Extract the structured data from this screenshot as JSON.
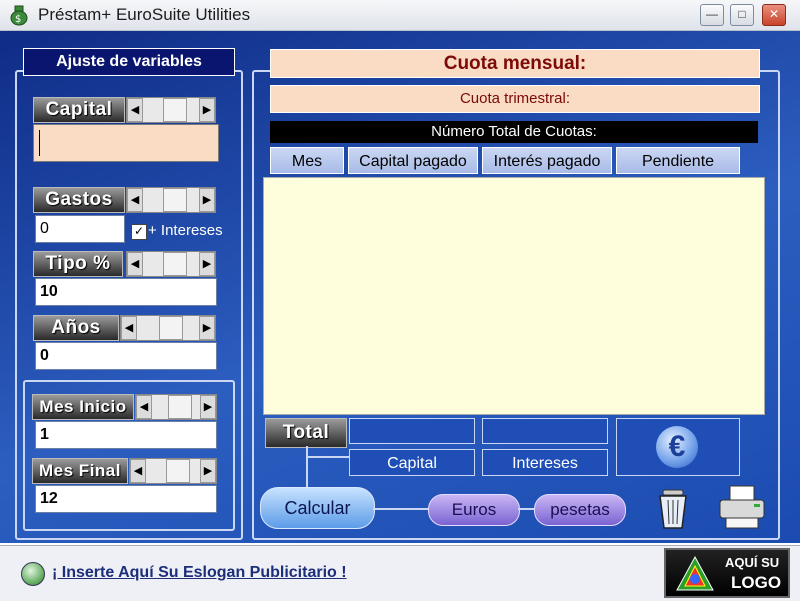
{
  "window": {
    "title": "Préstam+ EuroSuite Utilities",
    "min": "—",
    "max": "□",
    "close": "✕"
  },
  "left": {
    "title": "Ajuste de variables",
    "capital": {
      "label": "Capital",
      "value": ""
    },
    "gastos": {
      "label": "Gastos",
      "value": "0",
      "check_label": "+ Intereses",
      "checked": "✓"
    },
    "tipo": {
      "label": "Tipo %",
      "value": "10"
    },
    "anos": {
      "label": "Años",
      "value": "0"
    },
    "mes_inicio": {
      "label": "Mes Inicio",
      "value": "1"
    },
    "mes_final": {
      "label": "Mes Final",
      "value": "12"
    },
    "arrows": {
      "left": "◀",
      "right": "▶"
    }
  },
  "right": {
    "cuota_mensual": "Cuota mensual:",
    "cuota_trimestral": "Cuota trimestral:",
    "numero_total": "Número Total de Cuotas:",
    "columns": [
      "Mes",
      "Capital pagado",
      "Interés pagado",
      "Pendiente"
    ],
    "total_label": "Total",
    "total_capital": "Capital",
    "total_intereses": "Intereses",
    "euro_symbol": "€",
    "calcular": "Calcular",
    "euros": "Euros",
    "pesetas": "pesetas"
  },
  "status": {
    "slogan": "¡ Inserte Aquí Su Eslogan Publicitario !",
    "logo_line1": "AQUÍ SU",
    "logo_line2": "LOGO"
  },
  "icons": [
    "app-icon",
    "minimize-icon",
    "maximize-icon",
    "close-icon",
    "euro-icon",
    "trash-icon",
    "printer-icon",
    "globe-icon",
    "logo-icon"
  ]
}
